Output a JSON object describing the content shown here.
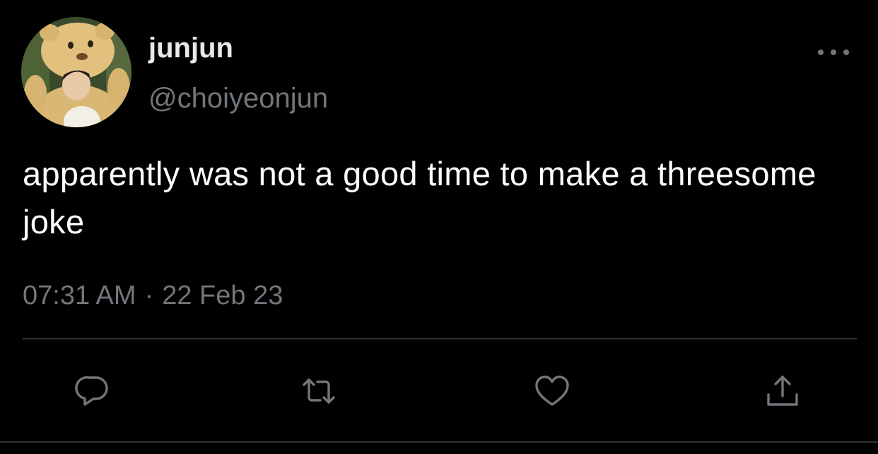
{
  "tweet": {
    "display_name": "junjun",
    "handle": "@choiyeonjun",
    "text": "apparently was not a good time to make a threesome joke",
    "time": "07:31 AM",
    "separator": "·",
    "date": "22 Feb 23"
  },
  "icons": {
    "more": "more-dots-icon",
    "reply": "reply-bubble-icon",
    "retweet": "retweet-arrows-icon",
    "like": "heart-icon",
    "share": "share-upload-icon"
  },
  "colors": {
    "background": "#000000",
    "primary_text": "#ffffff",
    "secondary_text": "#71767b",
    "divider": "#2f3336"
  }
}
